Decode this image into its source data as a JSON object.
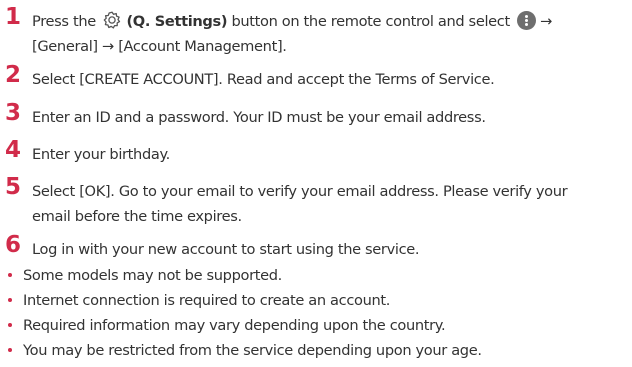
{
  "steps": [
    {
      "number": "1",
      "text_before": "Press the",
      "button_label": "(Q. Settings)",
      "text_middle": "button on the remote control and select",
      "text_arrow": "→",
      "line2": "[General] → [Account Management]."
    },
    {
      "number": "2",
      "text": "Select [CREATE ACCOUNT]. Read and accept the Terms of Service."
    },
    {
      "number": "3",
      "text": "Enter an ID and a password. Your ID must be your email address."
    },
    {
      "number": "4",
      "text": "Enter your birthday."
    },
    {
      "number": "5",
      "line1": "Select [OK]. Go to your email to verify your email address. Please verify your",
      "line2": "email before the time expires."
    },
    {
      "number": "6",
      "text": "Log in with your new account to start using the service."
    }
  ],
  "notes": [
    "Some models may not be supported.",
    "Internet connection is required to create an account.",
    "Required information may vary depending upon the country.",
    "You may be restricted from the service depending upon your age."
  ],
  "icons": {
    "settings": "gear-icon",
    "more": "more-vertical-icon"
  },
  "colors": {
    "accent": "#d12b4a",
    "text": "#333333",
    "icon_gray": "#6e6e6e"
  }
}
